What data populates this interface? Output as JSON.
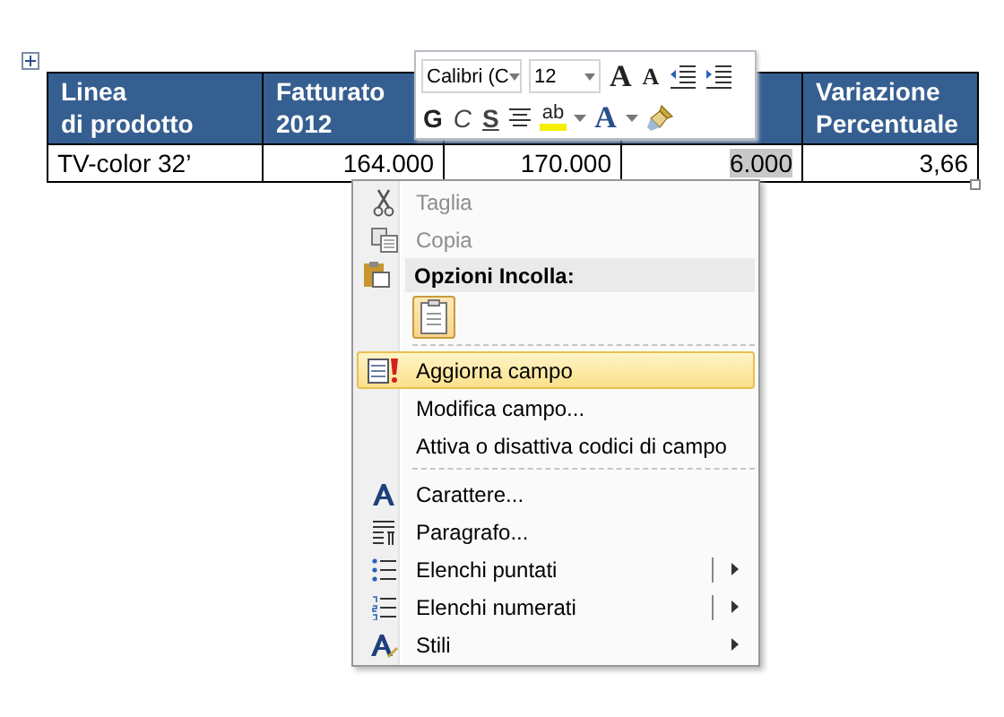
{
  "table": {
    "columns": [
      {
        "label": "Linea\ndi prodotto"
      },
      {
        "label": "Fatturato\n2012"
      },
      {},
      {},
      {
        "label": "Variazione\nPercentuale"
      }
    ],
    "rows": [
      {
        "cells": [
          {
            "text": "TV-color 32’",
            "selected": false
          },
          {
            "text": "164.000",
            "selected": false
          },
          {
            "text": "170.000",
            "selected": false
          },
          {
            "text": "6.000",
            "selected": true
          },
          {
            "text": "3,66",
            "selected": false
          }
        ]
      }
    ]
  },
  "mini_toolbar": {
    "font": "Calibri (C",
    "size": "12",
    "row1": [
      {
        "kind": "grow",
        "glyph": "A"
      },
      {
        "kind": "shrink",
        "glyph": "A"
      },
      {
        "kind": "outdent"
      },
      {
        "kind": "indent"
      }
    ],
    "row2": [
      {
        "kind": "bold",
        "glyph": "G"
      },
      {
        "kind": "italic",
        "glyph": "C"
      },
      {
        "kind": "underline",
        "glyph": "S"
      },
      {
        "kind": "center"
      },
      {
        "kind": "highlight",
        "glyph": "ab"
      },
      {
        "kind": "dropdown"
      },
      {
        "kind": "fontcolor",
        "glyph": "A"
      },
      {
        "kind": "dropdown"
      },
      {
        "kind": "painter"
      }
    ]
  },
  "context_menu": [
    {
      "kind": "item",
      "label": "Taglia",
      "disabled": true,
      "highlighted": false,
      "submenu": false,
      "split": false
    },
    {
      "kind": "item",
      "label": "Copia",
      "disabled": true,
      "highlighted": false,
      "submenu": false,
      "split": false
    },
    {
      "kind": "header",
      "label": "Opzioni Incolla:"
    },
    {
      "kind": "paste"
    },
    {
      "kind": "separator"
    },
    {
      "kind": "item",
      "label": "Aggiorna campo",
      "disabled": false,
      "highlighted": true,
      "submenu": false,
      "split": false
    },
    {
      "kind": "item",
      "label": "Modifica campo...",
      "disabled": false,
      "highlighted": false,
      "submenu": false,
      "split": false
    },
    {
      "kind": "item",
      "label": "Attiva o disattiva codici di campo",
      "disabled": false,
      "highlighted": false,
      "submenu": false,
      "split": false
    },
    {
      "kind": "separator"
    },
    {
      "kind": "item",
      "label": "Carattere...",
      "disabled": false,
      "highlighted": false,
      "submenu": false,
      "split": false
    },
    {
      "kind": "item",
      "label": "Paragrafo...",
      "disabled": false,
      "highlighted": false,
      "submenu": false,
      "split": false
    },
    {
      "kind": "item",
      "label": "Elenchi puntati",
      "disabled": false,
      "highlighted": false,
      "submenu": true,
      "split": true
    },
    {
      "kind": "item",
      "label": "Elenchi numerati",
      "disabled": false,
      "highlighted": false,
      "submenu": true,
      "split": true
    },
    {
      "kind": "item",
      "label": "Stili",
      "disabled": false,
      "highlighted": false,
      "submenu": true,
      "split": false
    }
  ]
}
